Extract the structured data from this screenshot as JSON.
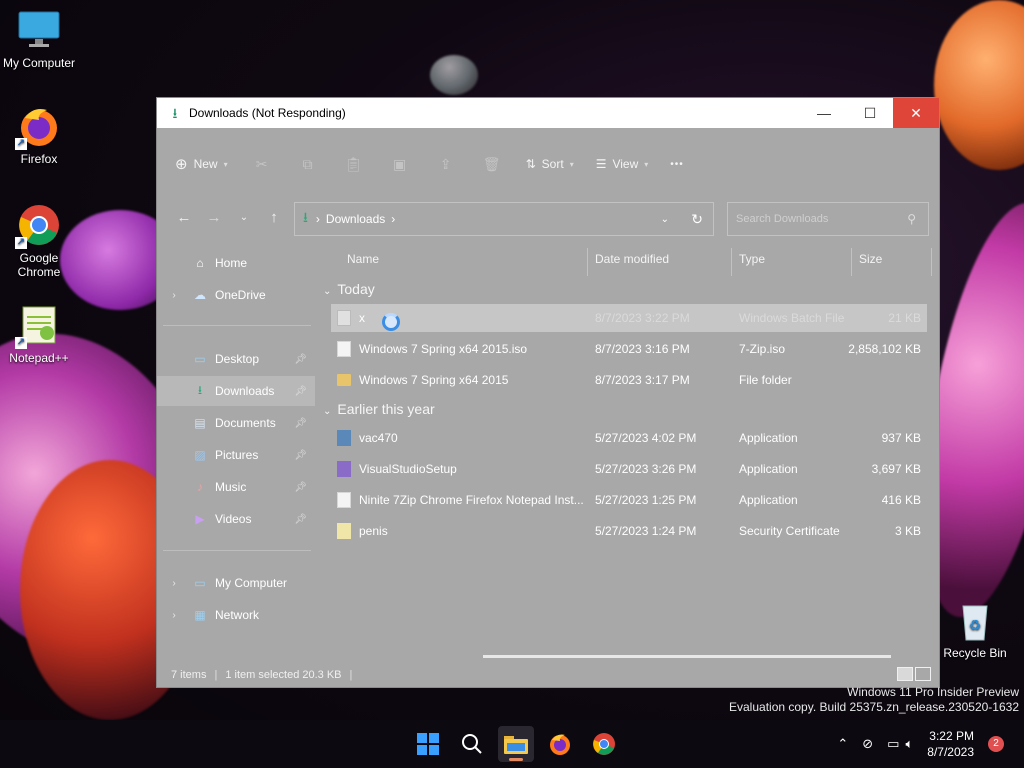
{
  "desktop": {
    "icons": [
      {
        "label": "My Computer"
      },
      {
        "label": "Firefox"
      },
      {
        "label": "Google Chrome"
      },
      {
        "label": "Notepad++"
      },
      {
        "label": "Recycle Bin"
      }
    ],
    "watermark_line1": "Windows 11 Pro Insider Preview",
    "watermark_line2": "Evaluation copy. Build 25375.zn_release.230520-1632"
  },
  "window": {
    "title": "Downloads (Not Responding)",
    "toolbar": {
      "new_label": "New",
      "sort_label": "Sort",
      "view_label": "View",
      "more_label": "•••"
    },
    "address": {
      "path_label": "Downloads",
      "search_placeholder": "Search Downloads"
    },
    "nav": {
      "home": "Home",
      "onedrive": "OneDrive",
      "desktop": "Desktop",
      "downloads": "Downloads",
      "documents": "Documents",
      "pictures": "Pictures",
      "music": "Music",
      "videos": "Videos",
      "my_computer": "My Computer",
      "network": "Network"
    },
    "columns": {
      "name": "Name",
      "date": "Date modified",
      "type": "Type",
      "size": "Size"
    },
    "groups": {
      "today": "Today",
      "earlier": "Earlier this year"
    },
    "files": [
      {
        "name": "x",
        "date": "8/7/2023 3:22 PM",
        "type": "Windows Batch File",
        "size": "21 KB",
        "icon": "batch-file-icon",
        "selected": true
      },
      {
        "name": "Windows 7 Spring x64  2015.iso",
        "date": "8/7/2023 3:16 PM",
        "type": "7-Zip.iso",
        "size": "2,858,102 KB",
        "icon": "document-icon"
      },
      {
        "name": "Windows 7 Spring x64  2015",
        "date": "8/7/2023 3:17 PM",
        "type": "File folder",
        "size": "",
        "icon": "folder-icon"
      },
      {
        "name": "vac470",
        "date": "5/27/2023 4:02 PM",
        "type": "Application",
        "size": "937 KB",
        "icon": "application-icon"
      },
      {
        "name": "VisualStudioSetup",
        "date": "5/27/2023 3:26 PM",
        "type": "Application",
        "size": "3,697 KB",
        "icon": "visual-studio-icon"
      },
      {
        "name": "Ninite 7Zip Chrome Firefox Notepad Inst...",
        "date": "5/27/2023 1:25 PM",
        "type": "Application",
        "size": "416 KB",
        "icon": "document-icon"
      },
      {
        "name": "penis",
        "date": "5/27/2023 1:24 PM",
        "type": "Security Certificate",
        "size": "3 KB",
        "icon": "certificate-icon"
      }
    ],
    "status": {
      "items": "7 items",
      "selected": "1 item selected  20.3 KB"
    }
  },
  "taskbar": {
    "time": "3:22 PM",
    "date": "8/7/2023",
    "notification_count": "2"
  }
}
